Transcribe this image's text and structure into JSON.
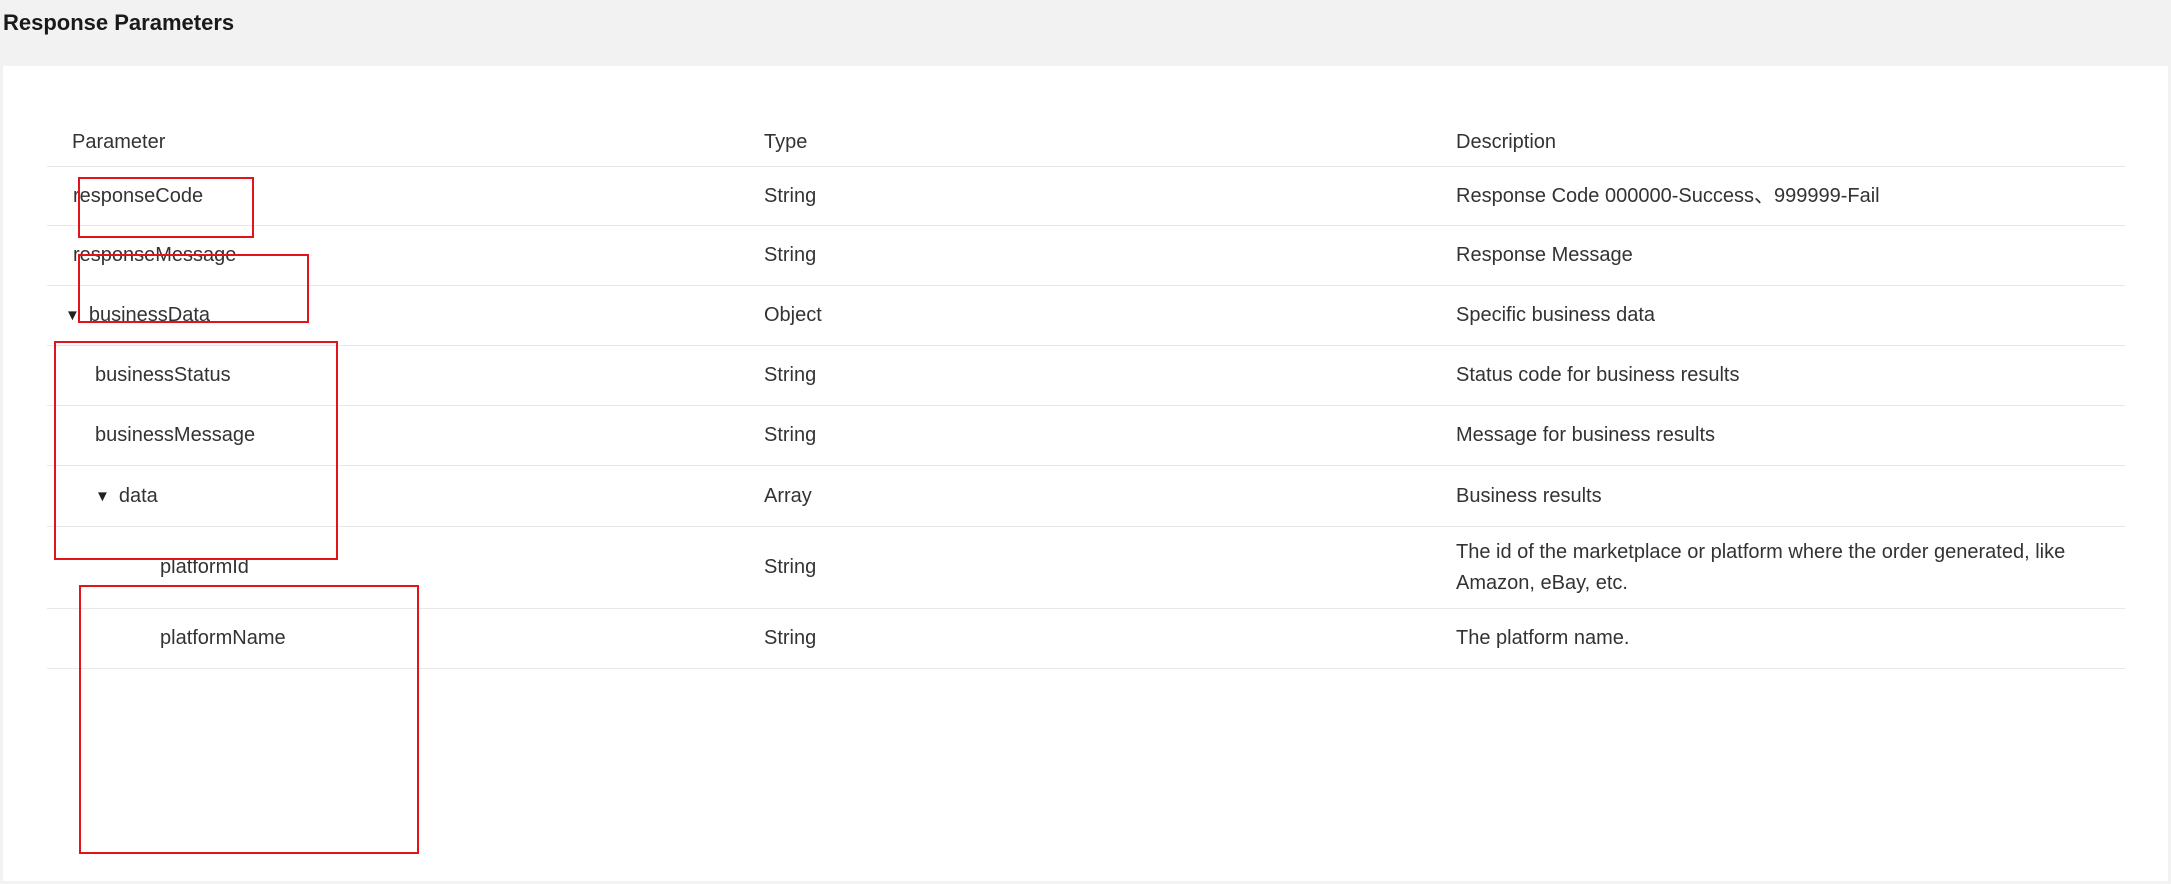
{
  "section": {
    "title": "Response Parameters"
  },
  "table": {
    "headers": {
      "parameter": "Parameter",
      "type": "Type",
      "description": "Description"
    },
    "rows": [
      {
        "param": "responseCode",
        "type": "String",
        "description": "Response Code  000000-Success、999999-Fail"
      },
      {
        "param": "responseMessage",
        "type": "String",
        "description": "Response Message"
      },
      {
        "param": "businessData",
        "type": "Object",
        "description": "Specific business data",
        "caret": "▼"
      },
      {
        "param": "businessStatus",
        "type": "String",
        "description": "Status code for business results"
      },
      {
        "param": "businessMessage",
        "type": "String",
        "description": "Message for business results"
      },
      {
        "param": "data",
        "type": "Array",
        "description": "Business results",
        "caret": "▼"
      },
      {
        "param": "platformId",
        "type": "String",
        "description": "The id of the marketplace or platform where the order generated, like Amazon, eBay, etc."
      },
      {
        "param": "platformName",
        "type": "String",
        "description": "The platform name."
      }
    ]
  },
  "colors": {
    "highlight_border": "#e0151c",
    "row_divider": "#e8e8e8",
    "page_background": "#f2f2f2"
  }
}
